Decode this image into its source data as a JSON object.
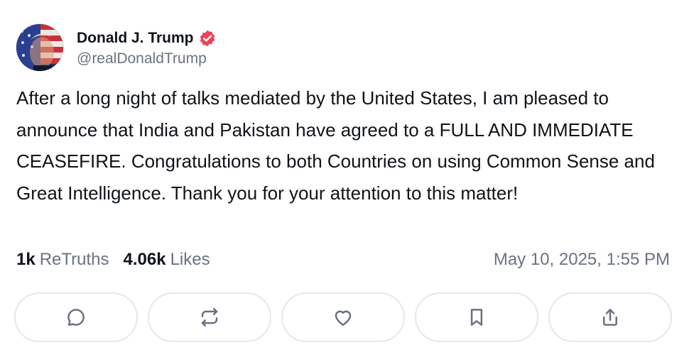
{
  "author": {
    "display_name": "Donald J. Trump",
    "handle": "@realDonaldTrump",
    "verified": true,
    "verified_color": "#e8455c"
  },
  "post": {
    "text": "After a long night of talks mediated by the United States, I am pleased to announce that India and Pakistan have agreed to a FULL AND IMMEDIATE CEASEFIRE. Congratulations to both Countries on using Common Sense and Great Intelligence. Thank you for your attention to this matter!"
  },
  "stats": {
    "retruths_count": "1k",
    "retruths_label": "ReTruths",
    "likes_count": "4.06k",
    "likes_label": "Likes",
    "timestamp": "May 10, 2025, 1:55 PM"
  },
  "actions": [
    {
      "icon": "reply-icon"
    },
    {
      "icon": "retruth-icon"
    },
    {
      "icon": "like-icon"
    },
    {
      "icon": "bookmark-icon"
    },
    {
      "icon": "share-icon"
    }
  ],
  "colors": {
    "text": "#0f1419",
    "muted": "#6b7280",
    "border": "#e5e7eb"
  }
}
